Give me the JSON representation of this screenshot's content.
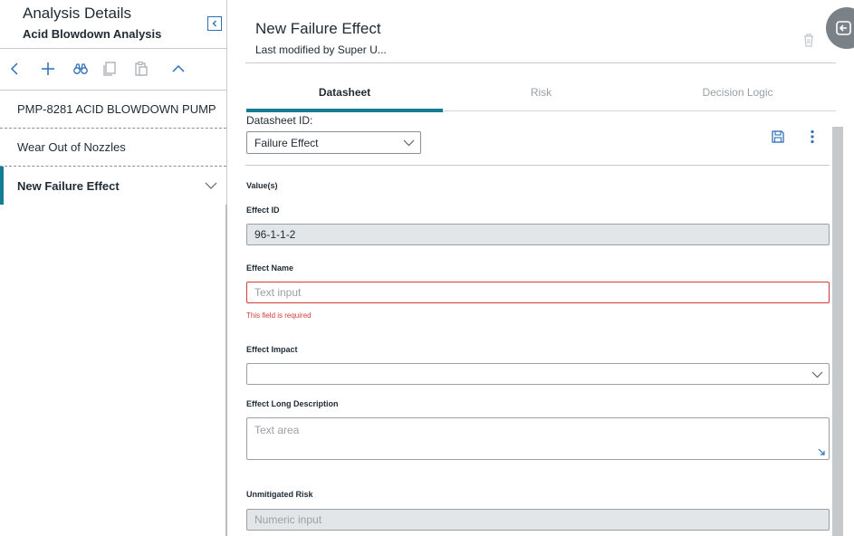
{
  "left_panel": {
    "title": "Analysis Details",
    "subtitle": "Acid Blowdown Analysis",
    "toolbar": [
      "back-icon",
      "add-icon",
      "binoculars-icon",
      "copy-icon",
      "paste-icon",
      "chevron-up-icon"
    ],
    "tree_items": [
      {
        "label": "PMP-8281 ACID BLOWDOWN PUMP",
        "selected": false
      },
      {
        "label": "Wear Out of Nozzles",
        "selected": false
      },
      {
        "label": "New Failure Effect",
        "selected": true
      }
    ]
  },
  "record": {
    "title": "New Failure Effect",
    "modified": "Last modified by Super U..."
  },
  "tabs": [
    {
      "label": "Datasheet",
      "active": true
    },
    {
      "label": "Risk",
      "active": false
    },
    {
      "label": "Decision Logic",
      "active": false
    }
  ],
  "datasheet": {
    "id_label": "Datasheet ID:",
    "selected": "Failure Effect"
  },
  "form": {
    "section": "Value(s)",
    "effect_id_label": "Effect ID",
    "effect_id_value": "96-1-1-2",
    "effect_name_label": "Effect Name",
    "effect_name_placeholder": "Text input",
    "effect_name_error": "This field is required",
    "effect_impact_label": "Effect Impact",
    "effect_impact_value": "",
    "effect_long_desc_label": "Effect Long Description",
    "effect_long_desc_placeholder": "Text area",
    "unmitigated_risk_label": "Unmitigated Risk",
    "unmitigated_risk_placeholder": "Numeric input"
  },
  "colors": {
    "accent": "#127d93",
    "error": "#d33a3a",
    "link_blue": "#2d6fb8",
    "readonly_bg": "#e3e6e9"
  }
}
